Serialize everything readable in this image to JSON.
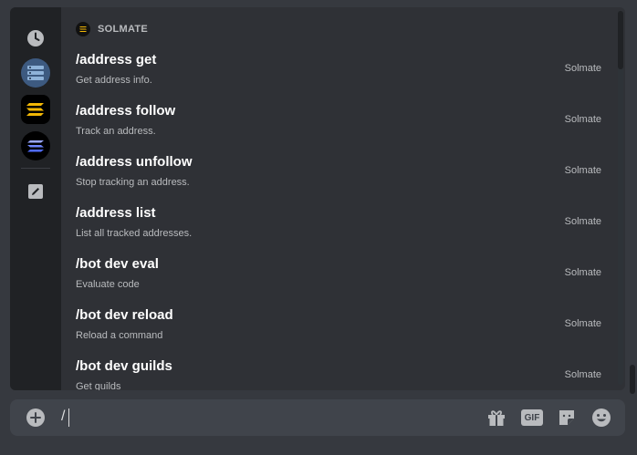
{
  "app": {
    "accent": "#5865f2"
  },
  "rail": {
    "items": [
      {
        "name": "recent",
        "icon": "clock-icon"
      },
      {
        "name": "server",
        "icon": "server-avatar-icon"
      },
      {
        "name": "solmate-app",
        "icon": "solmate-logo-icon"
      },
      {
        "name": "solana-app",
        "icon": "solana-logo-icon"
      },
      {
        "name": "built-in",
        "icon": "pencil-icon"
      }
    ]
  },
  "section": {
    "title": "SOLMATE",
    "icon": "solmate-logo-icon"
  },
  "commands": [
    {
      "name": "/address get",
      "description": "Get address info.",
      "source": "Solmate"
    },
    {
      "name": "/address follow",
      "description": "Track an address.",
      "source": "Solmate"
    },
    {
      "name": "/address unfollow",
      "description": "Stop tracking an address.",
      "source": "Solmate"
    },
    {
      "name": "/address list",
      "description": "List all tracked addresses.",
      "source": "Solmate"
    },
    {
      "name": "/bot dev eval",
      "description": "Evaluate code",
      "source": "Solmate"
    },
    {
      "name": "/bot dev reload",
      "description": "Reload a command",
      "source": "Solmate"
    },
    {
      "name": "/bot dev guilds",
      "description": "Get guilds",
      "source": "Solmate"
    }
  ],
  "input": {
    "value": "/",
    "gif_label": "GIF"
  },
  "toolbar_icons": [
    "plus-circle-icon",
    "gift-icon",
    "gif-icon",
    "sticker-icon",
    "emoji-icon"
  ]
}
